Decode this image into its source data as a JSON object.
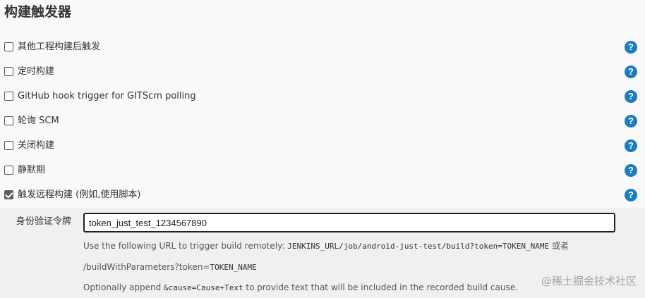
{
  "section": {
    "title": "构建触发器"
  },
  "triggers": [
    {
      "label": "其他工程构建后触发",
      "checked": false
    },
    {
      "label": "定时构建",
      "checked": false
    },
    {
      "label": "GitHub hook trigger for GITScm polling",
      "checked": false
    },
    {
      "label": "轮询 SCM",
      "checked": false
    },
    {
      "label": "关闭构建",
      "checked": false
    },
    {
      "label": "静默期",
      "checked": false
    },
    {
      "label": "触发远程构建 (例如,使用脚本)",
      "checked": true
    }
  ],
  "help_icon_glyph": "?",
  "remote_trigger": {
    "token_label": "身份验证令牌",
    "token_value": "token_just_test_1234567890",
    "desc_line1_prefix": "Use the following URL to trigger build remotely: ",
    "desc_line1_url": "JENKINS_URL/job/android-just-test/build?token=TOKEN_NAME",
    "desc_line1_suffix": " 或者",
    "desc_line2_prefix": "/buildWithParameters?token=",
    "desc_line2_code": "TOKEN_NAME",
    "desc_line3_prefix": "Optionally append ",
    "desc_line3_code": "&cause=Cause+Text",
    "desc_line3_suffix": " to provide text that will be included in the recorded build cause."
  },
  "watermark": "@稀土掘金技术社区",
  "colors": {
    "help_icon": "#1a7dc4",
    "checkbox_checked": "#5f5f5f",
    "panel_bg": "#f0f0f0",
    "page_bg": "#f9f9f9"
  }
}
